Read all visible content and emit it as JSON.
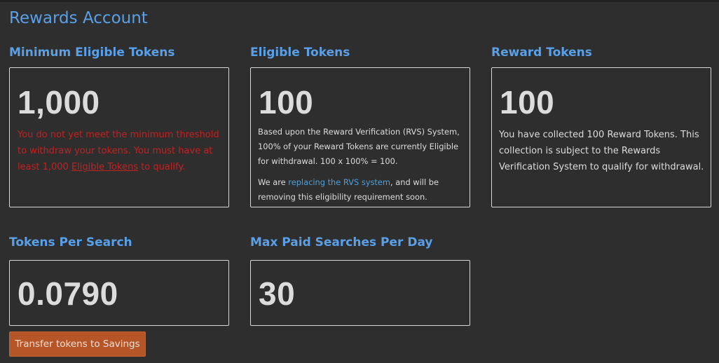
{
  "page": {
    "title": "Rewards Account"
  },
  "minimum_eligible": {
    "label": "Minimum Eligible Tokens",
    "value": "1,000",
    "message_part1": "You do not yet meet the minimum threshold to withdraw your tokens. You must have at least 1,000 ",
    "message_link": "Eligible Tokens",
    "message_part2": " to qualify."
  },
  "eligible_tokens": {
    "label": "Eligible Tokens",
    "value": "100",
    "description": "Based upon the Reward Verification (RVS) System, 100% of your Reward Tokens are currently Eligible for withdrawal. 100 x 100% = 100.",
    "note_part1": "We are ",
    "note_link": "replacing the RVS system",
    "note_part2": ", and will be removing this eligibility requirement soon."
  },
  "reward_tokens": {
    "label": "Reward Tokens",
    "value": "100",
    "description": "You have collected 100 Reward Tokens. This collection is subject to the Rewards Verification System to qualify for withdrawal."
  },
  "tokens_per_search": {
    "label": "Tokens Per Search",
    "value": "0.0790"
  },
  "max_paid_searches": {
    "label": "Max Paid Searches Per Day",
    "value": "30"
  },
  "actions": {
    "transfer_label": "Transfer tokens to Savings"
  },
  "colors": {
    "background": "#2e2e2e",
    "heading_blue": "#5aa0e8",
    "warning_red": "#c42121",
    "link_blue": "#4f9fd8",
    "button_orange": "#b65528"
  }
}
